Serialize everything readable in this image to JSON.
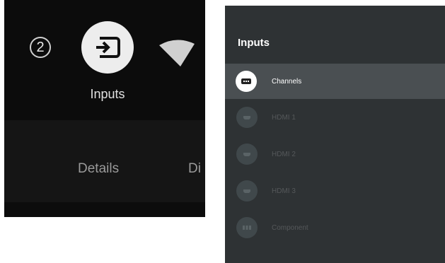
{
  "left_panel": {
    "badge": "2",
    "inputs_label": "Inputs",
    "details_label": "Details",
    "display_label": "Di"
  },
  "right_panel": {
    "title": "Inputs",
    "items": [
      {
        "label": "Channels",
        "icon": "tv-icon",
        "selected": true
      },
      {
        "label": "HDMI 1",
        "icon": "hdmi-icon",
        "selected": false
      },
      {
        "label": "HDMI 2",
        "icon": "hdmi-icon",
        "selected": false
      },
      {
        "label": "HDMI 3",
        "icon": "hdmi-icon",
        "selected": false
      },
      {
        "label": "Component",
        "icon": "component-icon",
        "selected": false
      }
    ]
  },
  "colors": {
    "left_bg": "#0c0c0c",
    "right_bg": "#2e3234",
    "selected_row": "#4a4f52"
  }
}
